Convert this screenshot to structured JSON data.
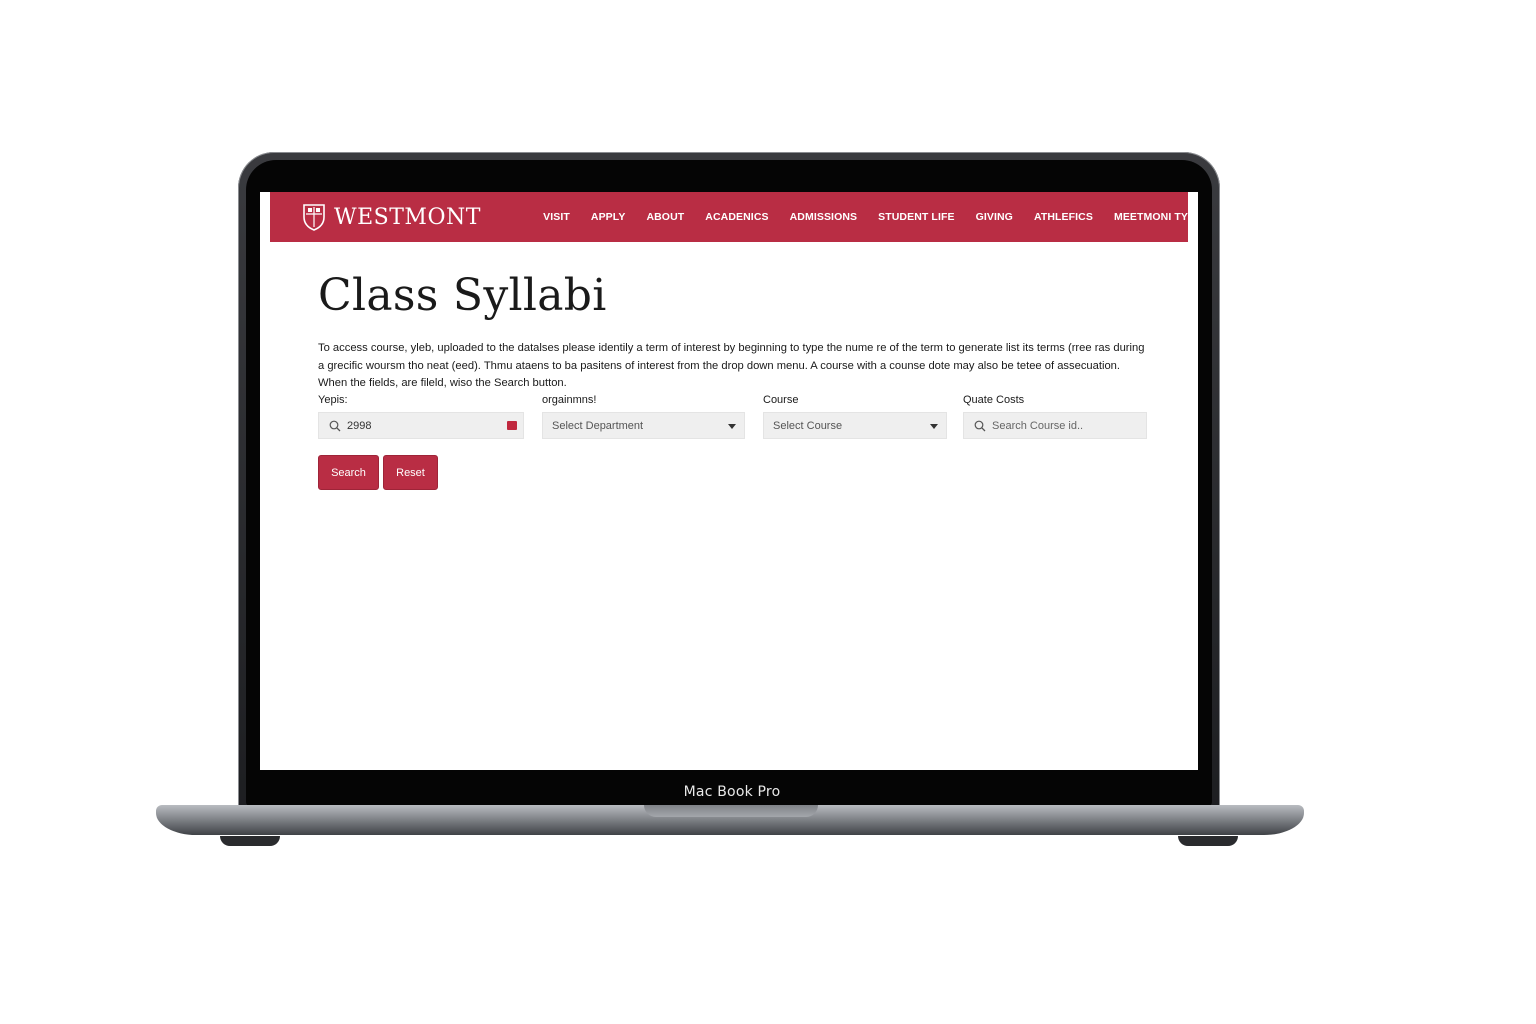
{
  "device": {
    "label": "Mac Book Pro"
  },
  "site": {
    "logo_text": "WESTMONT",
    "nav": [
      "VISIT",
      "APPLY",
      "ABOUT",
      "ACADENICS",
      "ADMISSIONS",
      "STUDENT LIFE",
      "GIVING",
      "ATHLEFICS",
      "MEETMONI TY"
    ],
    "brand_color": "#b92d44"
  },
  "page": {
    "title": "Class Syllabi",
    "intro": "To access course, yleb, uploaded to the datalses please identily a term of interest by beginning to type the nume re of the term to generate list its terms (rree ras during a grecific woursm tho neat (eed). Thmu ataens to ba pasitens of interest from the drop down menu. A course with a counse dote may also be tetee of assecuation. When the fields, are fileld, wiso the Search button."
  },
  "filters": {
    "term": {
      "label": "Yepis:",
      "value": "2998"
    },
    "department": {
      "label": "orgainmns!",
      "selected": "Select Department"
    },
    "course": {
      "label": "Course",
      "selected": "Select Course"
    },
    "course_id": {
      "label": "Quate Costs",
      "placeholder": "Search Course id.."
    }
  },
  "buttons": {
    "search": "Search",
    "reset": "Reset"
  }
}
